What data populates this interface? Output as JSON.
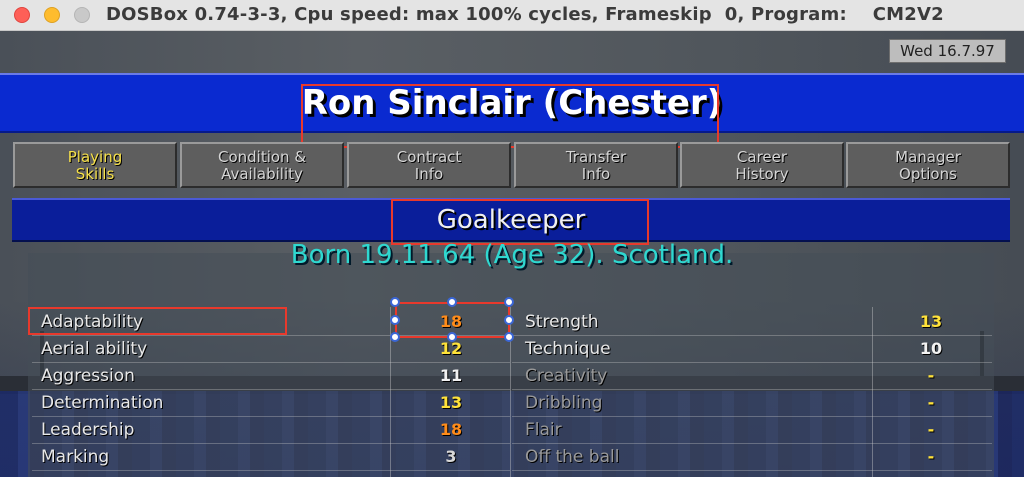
{
  "window": {
    "title": "DOSBox 0.74-3-3, Cpu speed: max 100% cycles, Frameskip  0, Program:    CM2V2"
  },
  "game": {
    "date": "Wed 16.7.97",
    "player_name": "Ron Sinclair (Chester)",
    "tabs": [
      {
        "line1": "Playing",
        "line2": "Skills"
      },
      {
        "line1": "Condition &",
        "line2": "Availability"
      },
      {
        "line1": "Contract",
        "line2": "Info"
      },
      {
        "line1": "Transfer",
        "line2": "Info"
      },
      {
        "line1": "Career",
        "line2": "History"
      },
      {
        "line1": "Manager",
        "line2": "Options"
      }
    ],
    "position": "Goalkeeper",
    "born": "Born 19.11.64 (Age 32). Scotland.",
    "left_attributes": [
      {
        "name": "Adaptability",
        "value": "18"
      },
      {
        "name": "Aerial ability",
        "value": "12"
      },
      {
        "name": "Aggression",
        "value": "11"
      },
      {
        "name": "Determination",
        "value": "13"
      },
      {
        "name": "Leadership",
        "value": "18"
      },
      {
        "name": "Marking",
        "value": "3"
      }
    ],
    "right_attributes": [
      {
        "name": "Strength",
        "value": "13"
      },
      {
        "name": "Technique",
        "value": "10"
      },
      {
        "name": "Creativity",
        "value": "-"
      },
      {
        "name": "Dribbling",
        "value": "-"
      },
      {
        "name": "Flair",
        "value": "-"
      },
      {
        "name": "Off the ball",
        "value": "-"
      }
    ]
  },
  "colors": {
    "value_high": "#ff8c1a",
    "value_good": "#ffe23a",
    "value_normal": "#f2f2f2",
    "value_low": "#d8d8d8",
    "value_na": "#ffe23a",
    "highlight_box": "#e8392c"
  }
}
